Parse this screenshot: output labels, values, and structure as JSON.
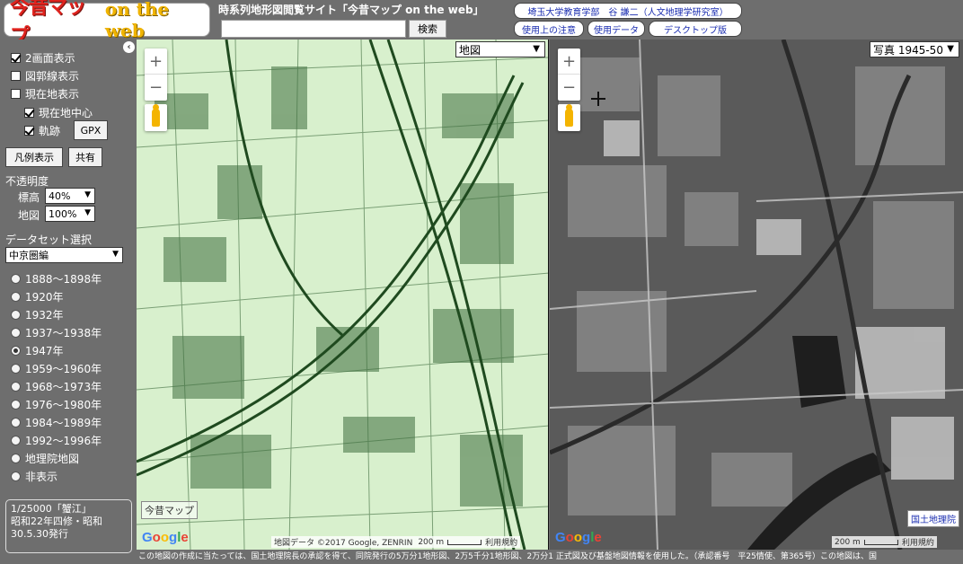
{
  "header": {
    "logo_main": "今昔マップ",
    "logo_sub": "on the web",
    "site_title": "時系列地形図閲覧サイト「今昔マップ on the web」",
    "search_placeholder": "",
    "search_button": "検索",
    "affiliation": "埼玉大学教育学部　谷 謙二（人文地理学研究室）",
    "notes_link": "使用上の注意",
    "data_link": "使用データ",
    "desktop_link": "デスクトップ版"
  },
  "sidebar": {
    "collapse": "‹",
    "options": {
      "dual_view": "2画面表示",
      "graticule": "図郭線表示",
      "current_location": "現在地表示",
      "center_on_location": "現在地中心",
      "track": "軌跡"
    },
    "gpx_button": "GPX",
    "legend_button": "凡例表示",
    "share_button": "共有",
    "opacity_heading": "不透明度",
    "elevation_label": "標高",
    "elevation_value": "40%",
    "map_label": "地図",
    "map_value": "100%",
    "dataset_heading": "データセット選択",
    "dataset_value": "中京圏編",
    "periods": [
      "1888～1898年",
      "1920年",
      "1932年",
      "1937～1938年",
      "1947年",
      "1959～1960年",
      "1968～1973年",
      "1976～1980年",
      "1984～1989年",
      "1992～1996年",
      "地理院地図",
      "非表示"
    ],
    "selected_period": "1947年",
    "info_box": "1/25000「蟹江」\n昭和22年四修・昭和30.5.30発行"
  },
  "map_left": {
    "layer_select": "地図",
    "zoom_in": "+",
    "zoom_out": "−",
    "label": "今昔マップ",
    "attribution": "地図データ ©2017 Google, ZENRIN",
    "scale": "200 m",
    "terms": "利用規約",
    "google": "Google"
  },
  "map_right": {
    "layer_select": "写真 1945-50",
    "zoom_in": "+",
    "zoom_out": "−",
    "label": "国土地理院",
    "scale": "200 m",
    "terms": "利用規約",
    "google": "Google"
  },
  "footer": {
    "text": "この地図の作成に当たっては、国土地理院長の承認を得て、同院発行の5万分1地形図、2万5千分1地形図、2万分1 正式図及び基盤地図情報を使用した。（承認番号　平25情使、第365号）この地図は、国"
  },
  "colors": {
    "chrome": "#6e6e6e",
    "old_map": "#d9f1cf",
    "link_blue": "#1a2db0",
    "logo_red": "#e0231e",
    "logo_yellow": "#f0b400"
  }
}
